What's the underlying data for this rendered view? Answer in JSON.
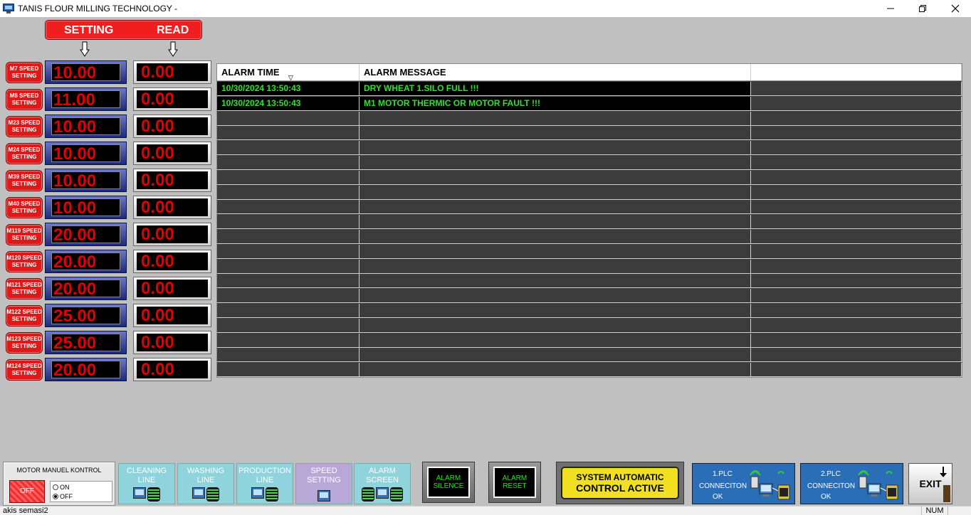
{
  "window": {
    "title": "TANIS FLOUR MILLING TECHNOLOGY -",
    "controls": [
      "minimize-icon",
      "maximize-icon",
      "close-icon"
    ]
  },
  "header": {
    "setting_label": "SETTING",
    "read_label": "READ"
  },
  "motors": [
    {
      "label_top": "M7 SPEED",
      "label_bottom": "SETTING",
      "setting": "10.00",
      "read": "0.00"
    },
    {
      "label_top": "M8 SPEED",
      "label_bottom": "SETTING",
      "setting": "11.00",
      "read": "0.00"
    },
    {
      "label_top": "M23 SPEED",
      "label_bottom": "SETTING",
      "setting": "10.00",
      "read": "0.00"
    },
    {
      "label_top": "M24 SPEED",
      "label_bottom": "SETTING",
      "setting": "10.00",
      "read": "0.00"
    },
    {
      "label_top": "M39 SPEED",
      "label_bottom": "SETTING",
      "setting": "10.00",
      "read": "0.00"
    },
    {
      "label_top": "M40 SPEED",
      "label_bottom": "SETTING",
      "setting": "10.00",
      "read": "0.00"
    },
    {
      "label_top": "M119 SPEED",
      "label_bottom": "SETTING",
      "setting": "20.00",
      "read": "0.00"
    },
    {
      "label_top": "M120 SPEED",
      "label_bottom": "SETTING",
      "setting": "20.00",
      "read": "0.00"
    },
    {
      "label_top": "M121 SPEED",
      "label_bottom": "SETTING",
      "setting": "20.00",
      "read": "0.00"
    },
    {
      "label_top": "M122 SPEED",
      "label_bottom": "SETTING",
      "setting": "25.00",
      "read": "0.00"
    },
    {
      "label_top": "M123 SPEED",
      "label_bottom": "SETTING",
      "setting": "25.00",
      "read": "0.00"
    },
    {
      "label_top": "M124 SPEED",
      "label_bottom": "SETTING",
      "setting": "20.00",
      "read": "0.00"
    }
  ],
  "alarm_table": {
    "columns": [
      "ALARM TIME",
      "ALARM MESSAGE",
      ""
    ],
    "rows": [
      {
        "time": "10/30/2024 13:50:43",
        "message": "DRY WHEAT 1.SILO FULL !!!"
      },
      {
        "time": "10/30/2024 13:50:43",
        "message": "M1 MOTOR THERMIC OR MOTOR FAULT !!!"
      }
    ],
    "empty_row_count": 18,
    "colors": {
      "text": "#33e033",
      "active_bg": "#000000",
      "empty_bg": "#3c3c3c"
    }
  },
  "motor_panel": {
    "title": "MOTOR MANUEL KONTROL",
    "off_button": "OFF",
    "radio_on": "ON",
    "radio_off": "OFF",
    "selected": "OFF"
  },
  "nav": [
    {
      "line1": "CLEANING",
      "line2": "LINE"
    },
    {
      "line1": "WASHING",
      "line2": "LINE"
    },
    {
      "line1": "PRODUCTION",
      "line2": "LINE"
    },
    {
      "line1": "SPEED",
      "line2": "SETTING"
    },
    {
      "line1": "ALARM",
      "line2": "SCREEN"
    }
  ],
  "alarm_buttons": {
    "silence": {
      "line1": "ALARM",
      "line2": "SILENCE"
    },
    "reset": {
      "line1": "ALARM",
      "line2": "RESET"
    }
  },
  "system_status": {
    "line1": "SYSTEM AUTOMATIC",
    "line2": "CONTROL ACTIVE"
  },
  "plc": [
    {
      "line1": "1.PLC",
      "line2": "CONNECITON",
      "line3": "OK"
    },
    {
      "line1": "2.PLC",
      "line2": "CONNECITON",
      "line3": "OK"
    }
  ],
  "exit_label": "EXIT",
  "statusbar": {
    "text": "akis semasi2",
    "num": "NUM"
  }
}
